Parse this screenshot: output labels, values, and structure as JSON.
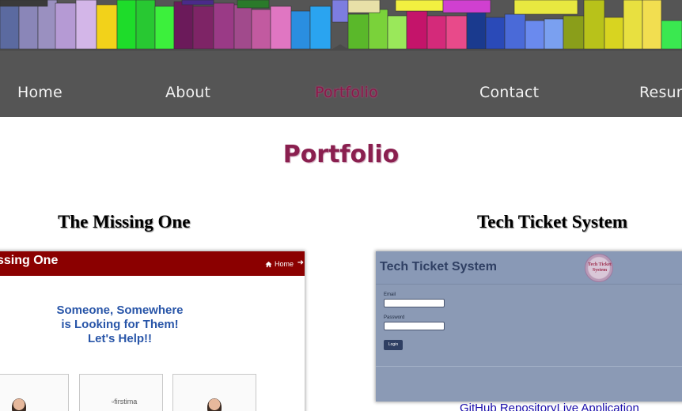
{
  "nav": {
    "home": "Home",
    "about": "About",
    "portfolio": "Portfolio",
    "contact": "Contact",
    "resume": "Resum"
  },
  "page_title": "Portfolio",
  "projects": [
    {
      "title": "The Missing One",
      "screenshot": {
        "brand": "ssing One",
        "home_link": "Home",
        "tagline": [
          "Someone, Somewhere",
          "is Looking for Them!",
          "Let's Help!!"
        ],
        "broken_image_alt": "firstima"
      }
    },
    {
      "title": "Tech Ticket System",
      "screenshot": {
        "app_title": "Tech Ticket System",
        "logo_text": "Tech Ticket System",
        "email_label": "Email",
        "password_label": "Password",
        "login_button": "Login"
      },
      "links": {
        "repo": "GitHub Repository",
        "live": "Live Application"
      }
    }
  ],
  "colors": {
    "nav_bg": "#555555",
    "accent": "#8a1f4f",
    "proj1_bar": "#8b0000",
    "proj2_bg": "#8b9ab5"
  }
}
